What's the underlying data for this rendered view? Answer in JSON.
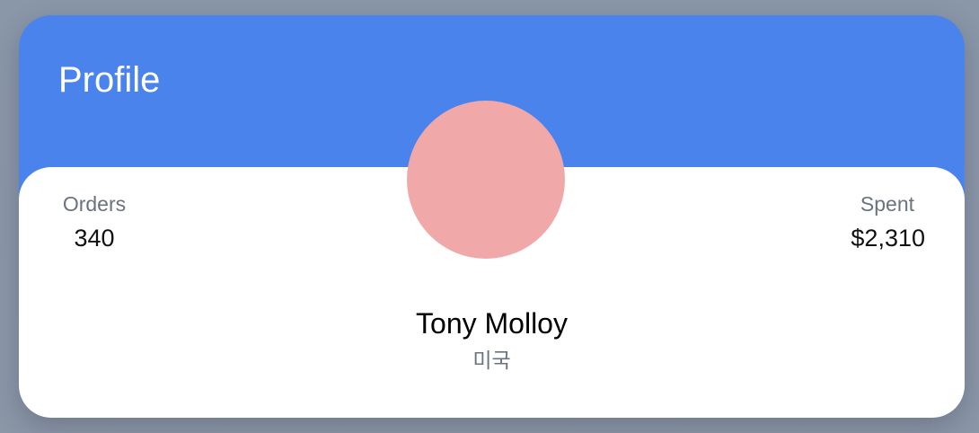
{
  "header": {
    "title": "Profile"
  },
  "stats": {
    "orders": {
      "label": "Orders",
      "value": "340"
    },
    "spent": {
      "label": "Spent",
      "value": "$2,310"
    }
  },
  "profile": {
    "name": "Tony Molloy",
    "country": "미국"
  },
  "colors": {
    "header": "#4a83ec",
    "avatar": "#f0a9a8",
    "muted_text": "#6b7280"
  }
}
